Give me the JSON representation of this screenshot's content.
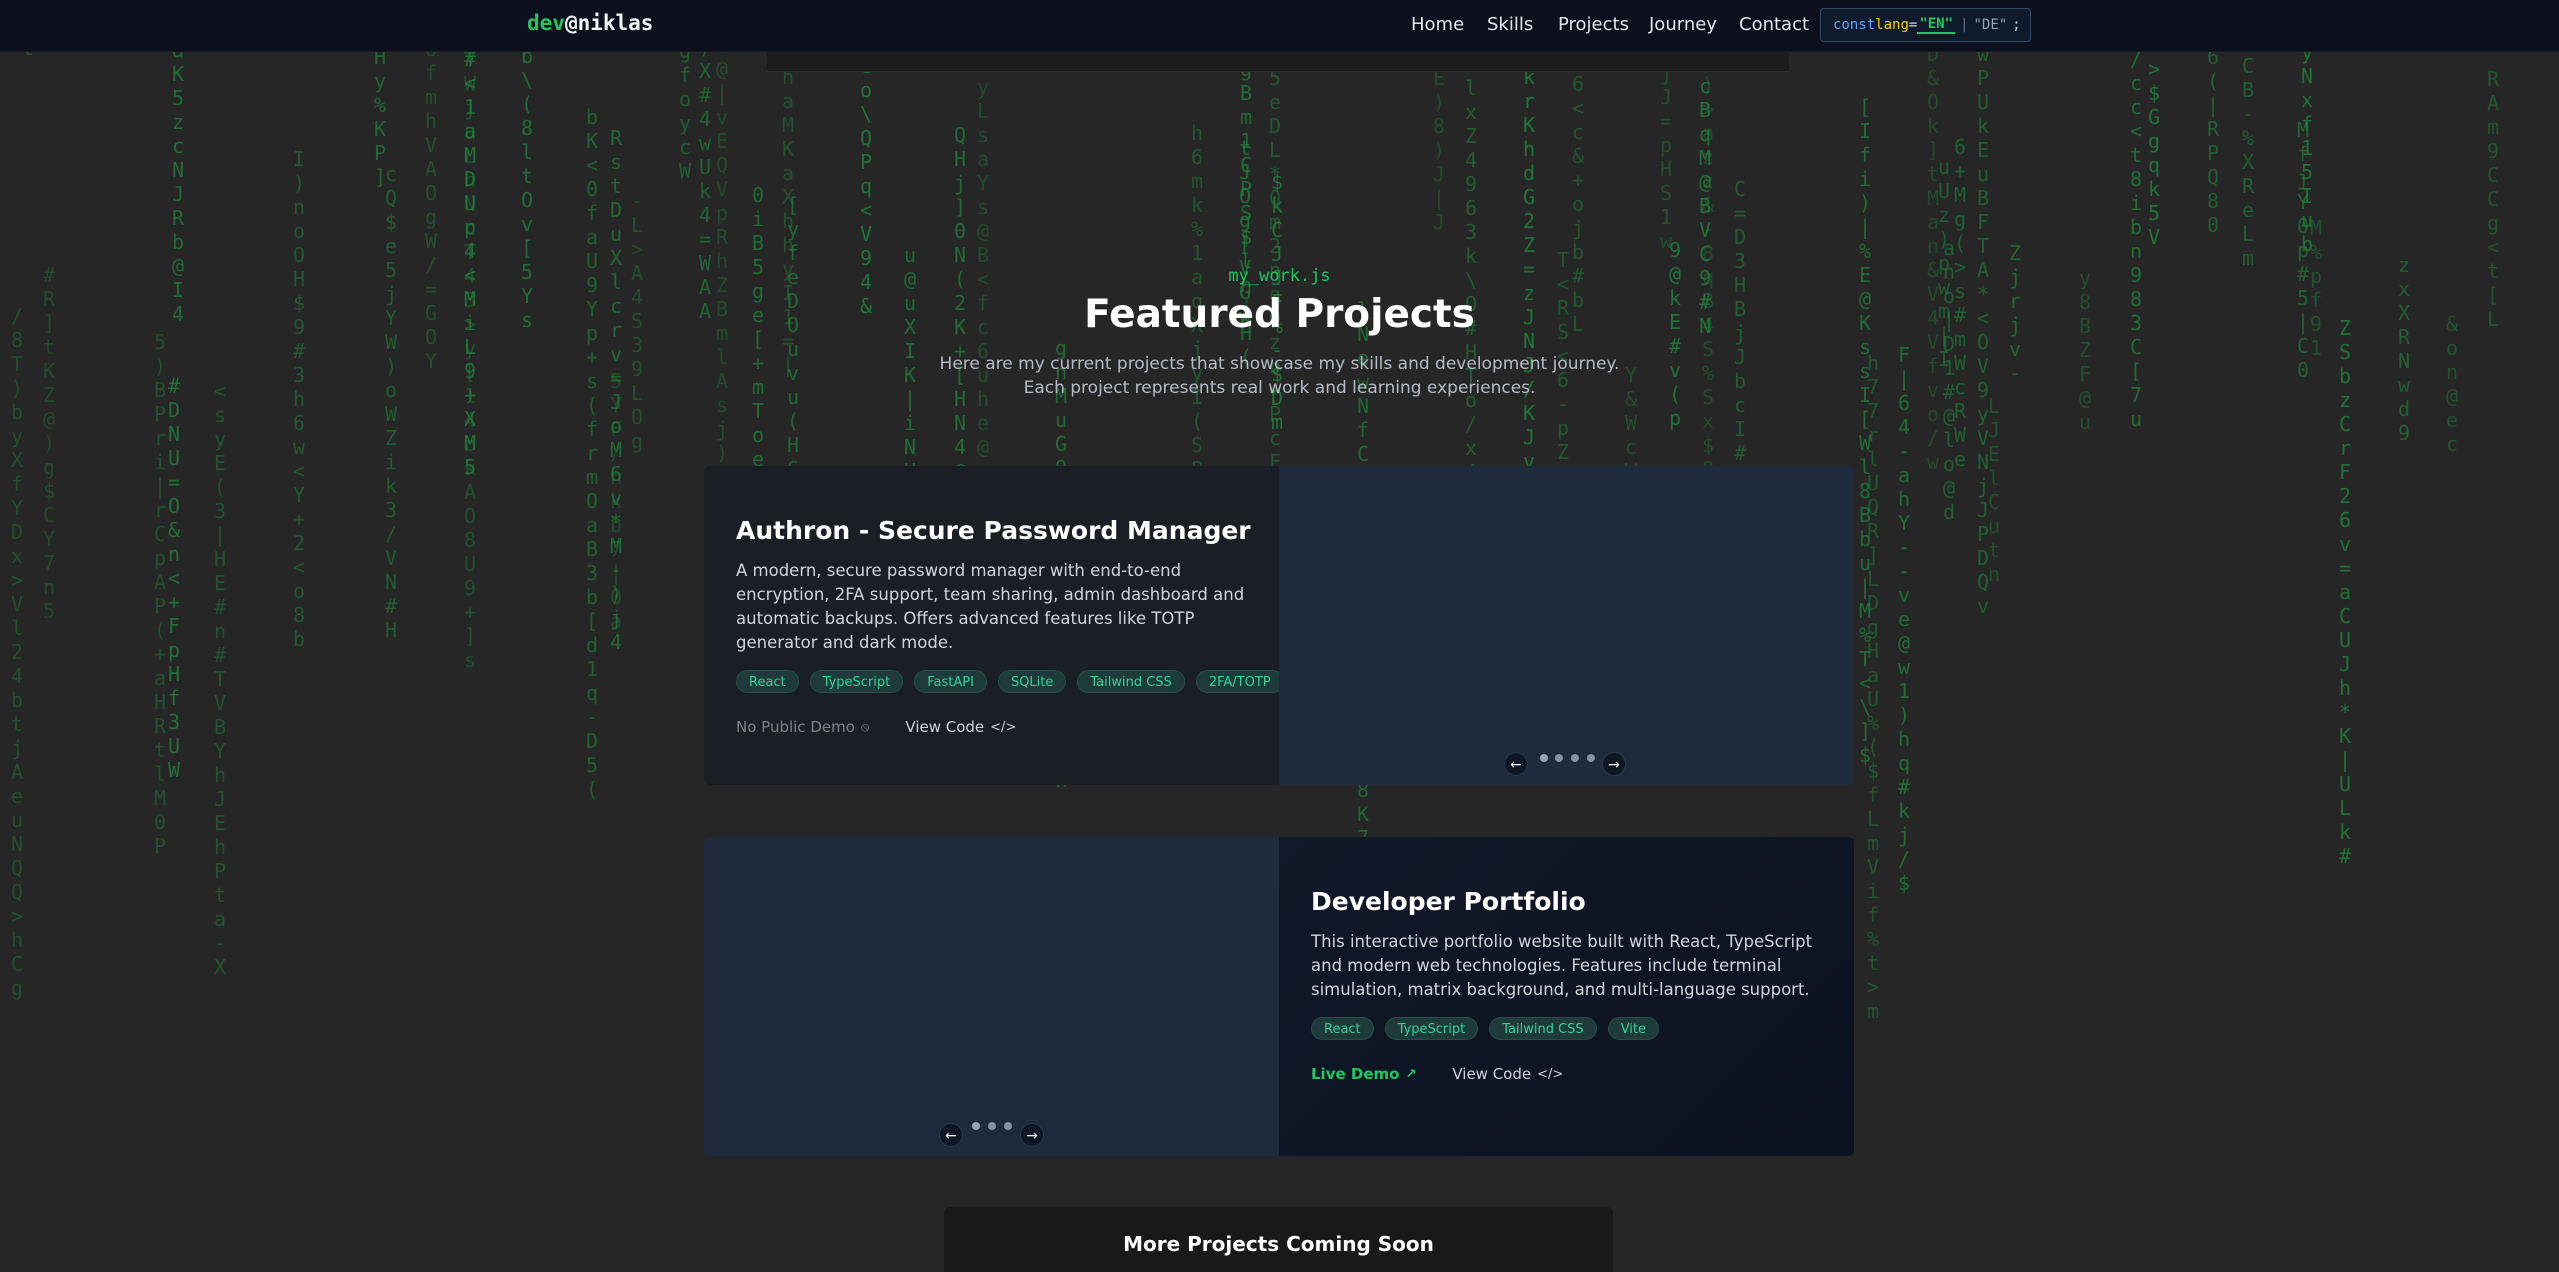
{
  "header": {
    "logo_prefix": "dev",
    "logo_suffix": "@niklas",
    "nav": [
      "Home",
      "Skills",
      "Projects",
      "Journey",
      "Contact"
    ],
    "lang": {
      "keyword": "const",
      "var": "lang",
      "eq": "=",
      "active": "\"EN\"",
      "sep": "|",
      "inactive": "\"DE\"",
      "semi": ";"
    }
  },
  "section": {
    "tag": "my_work.js",
    "title": "Featured Projects",
    "subtitle": "Here are my current projects that showcase my skills and development journey. Each project represents real work and learning experiences."
  },
  "projects": [
    {
      "title": "Authron - Secure Password Manager",
      "description": "A modern, secure password manager with end-to-end encryption, 2FA support, team sharing, admin dashboard and automatic backups. Offers advanced features like TOTP generator and dark mode.",
      "tags": [
        "React",
        "TypeScript",
        "FastAPI",
        "SQLite",
        "Tailwind CSS",
        "2FA/TOTP"
      ],
      "demo_label": "No Public Demo",
      "demo_icon": "no-demo-icon",
      "code_label": "View Code",
      "code_icon": "code-icon",
      "slide_count": 4,
      "active_slide": 0
    },
    {
      "title": "Developer Portfolio",
      "description": "This interactive portfolio website built with React, TypeScript and modern web technologies. Features include terminal simulation, matrix background, and multi-language support.",
      "tags": [
        "React",
        "TypeScript",
        "Tailwind CSS",
        "Vite"
      ],
      "demo_label": "Live Demo",
      "demo_icon": "external-link-icon",
      "code_label": "View Code",
      "code_icon": "code-icon",
      "slide_count": 3,
      "active_slide": 0
    }
  ],
  "carousel": {
    "prev": "←",
    "next": "→"
  },
  "coming_soon": {
    "title": "More Projects Coming Soon"
  },
  "colors": {
    "accent": "#22c55e",
    "background": "#262626",
    "header": "#0b101c",
    "matrix": "#1f8a3d",
    "tag_text": "#34d399"
  }
}
